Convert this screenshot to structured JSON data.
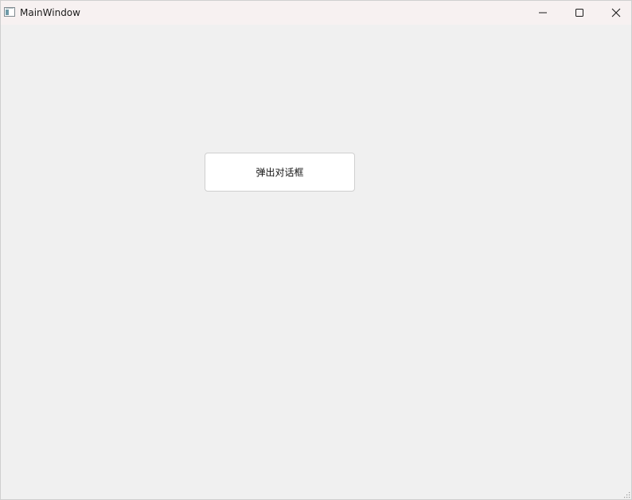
{
  "window": {
    "title": "MainWindow",
    "app_icon": "app-window-icon",
    "controls": {
      "minimize_icon": "minimize-icon",
      "maximize_icon": "maximize-icon",
      "close_icon": "close-icon"
    }
  },
  "main": {
    "dialog_button_label": "弹出对话框"
  },
  "colors": {
    "titlebar_bg": "#f7f1f1",
    "client_bg": "#f0f0f0",
    "button_bg": "#ffffff",
    "button_border": "#cfcfcf"
  }
}
